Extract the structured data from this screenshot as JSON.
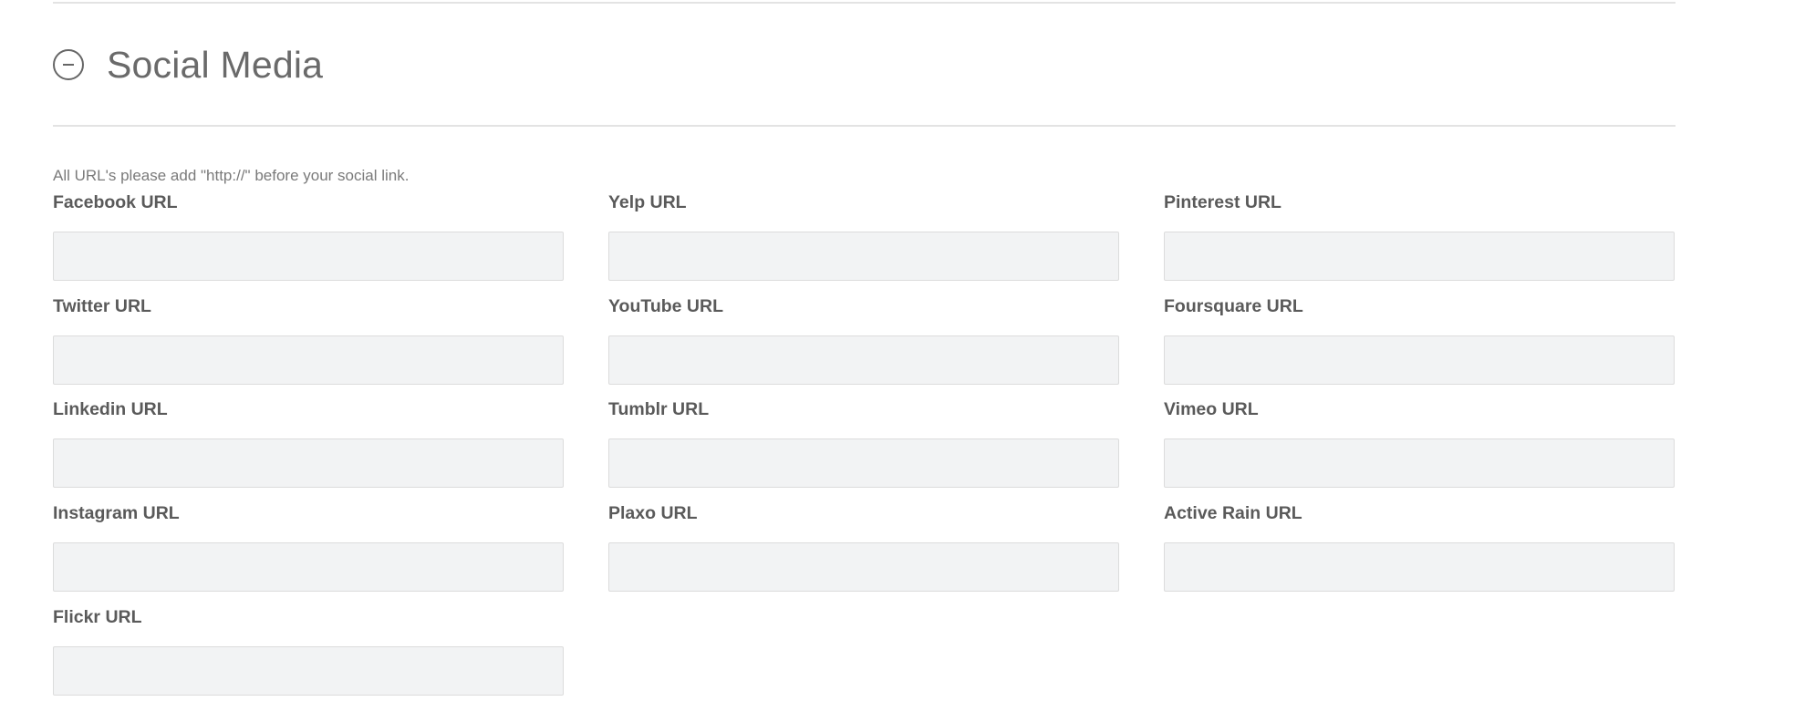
{
  "section": {
    "title": "Social Media",
    "help_text": "All URL's please add \"http://\" before your social link."
  },
  "fields": {
    "facebook": {
      "label": "Facebook URL",
      "value": ""
    },
    "yelp": {
      "label": "Yelp URL",
      "value": ""
    },
    "pinterest": {
      "label": "Pinterest URL",
      "value": ""
    },
    "twitter": {
      "label": "Twitter URL",
      "value": ""
    },
    "youtube": {
      "label": "YouTube URL",
      "value": ""
    },
    "foursquare": {
      "label": "Foursquare URL",
      "value": ""
    },
    "linkedin": {
      "label": "Linkedin URL",
      "value": ""
    },
    "tumblr": {
      "label": "Tumblr URL",
      "value": ""
    },
    "vimeo": {
      "label": "Vimeo URL",
      "value": ""
    },
    "instagram": {
      "label": "Instagram URL",
      "value": ""
    },
    "plaxo": {
      "label": "Plaxo URL",
      "value": ""
    },
    "active_rain": {
      "label": "Active Rain URL",
      "value": ""
    },
    "flickr": {
      "label": "Flickr URL",
      "value": ""
    }
  }
}
